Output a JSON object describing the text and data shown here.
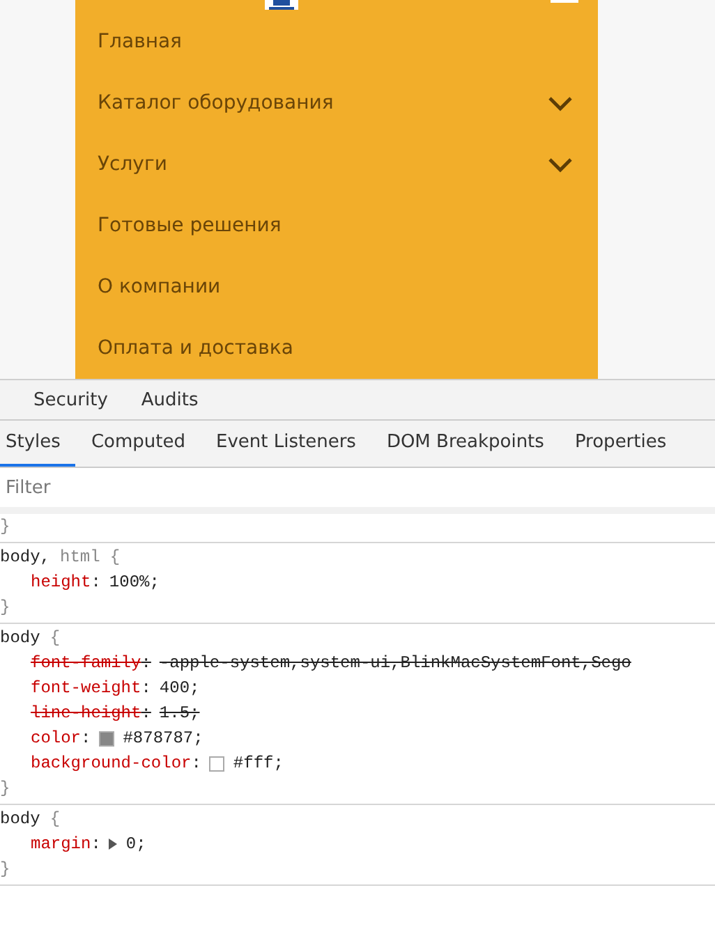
{
  "site_menu": {
    "items": [
      {
        "label": "Главная",
        "has_submenu": false
      },
      {
        "label": "Каталог оборудования",
        "has_submenu": true
      },
      {
        "label": "Услуги",
        "has_submenu": true
      },
      {
        "label": "Готовые решения",
        "has_submenu": false
      },
      {
        "label": "О компании",
        "has_submenu": false
      },
      {
        "label": "Оплата и доставка",
        "has_submenu": false
      }
    ]
  },
  "devtools": {
    "panel_tabs": [
      {
        "label": "Security"
      },
      {
        "label": "Audits"
      }
    ],
    "sidebar_tabs": [
      {
        "label": "Styles",
        "selected": true
      },
      {
        "label": "Computed",
        "selected": false
      },
      {
        "label": "Event Listeners",
        "selected": false
      },
      {
        "label": "DOM Breakpoints",
        "selected": false
      },
      {
        "label": "Properties",
        "selected": false
      }
    ],
    "filter": {
      "placeholder": "Filter"
    },
    "rules": [
      {
        "close_brace": "}"
      },
      {
        "selectors": [
          {
            "text": "body,",
            "matched": true
          },
          {
            "text": "html",
            "matched": false
          }
        ],
        "open_brace": "{",
        "close_brace": "}",
        "declarations": [
          {
            "property": "height",
            "colon": ":",
            "value": "100%;",
            "overridden": false
          }
        ]
      },
      {
        "selectors": [
          {
            "text": "body",
            "matched": true
          }
        ],
        "open_brace": "{",
        "close_brace": "}",
        "declarations": [
          {
            "property": "font-family",
            "colon": ":",
            "value": "-apple-system,system-ui,BlinkMacSystemFont,Sego",
            "overridden": true
          },
          {
            "property": "font-weight",
            "colon": ":",
            "value": "400;",
            "overridden": false
          },
          {
            "property": "line-height",
            "colon": ":",
            "value": "1.5;",
            "overridden": true
          },
          {
            "property": "color",
            "colon": ":",
            "value": "#878787;",
            "overridden": false,
            "color": "#878787"
          },
          {
            "property": "background-color",
            "colon": ":",
            "value": "#fff;",
            "overridden": false,
            "color": "#ffffff"
          }
        ]
      },
      {
        "selectors": [
          {
            "text": "body",
            "matched": true
          }
        ],
        "open_brace": "{",
        "close_brace": "}",
        "declarations": [
          {
            "property": "margin",
            "colon": ":",
            "value": "0;",
            "overridden": false,
            "expandable": true
          }
        ]
      }
    ]
  }
}
